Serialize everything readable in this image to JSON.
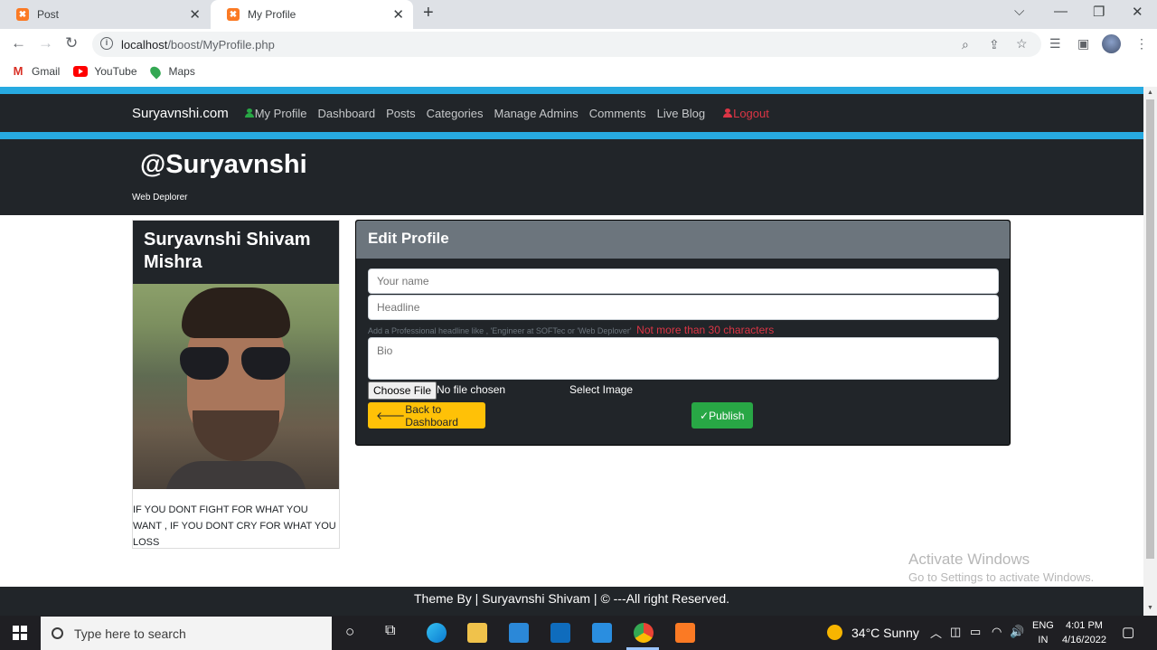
{
  "browser": {
    "tabs": [
      {
        "title": "Post",
        "active": false
      },
      {
        "title": "My Profile",
        "active": true
      }
    ],
    "url_host": "localhost",
    "url_path": "/boost/MyProfile.php",
    "bookmarks": [
      "Gmail",
      "YouTube",
      "Maps"
    ]
  },
  "site": {
    "brand": "Suryavnshi.com",
    "nav": [
      "My Profile",
      "Dashboard",
      "Posts",
      "Categories",
      "Manage Admins",
      "Comments",
      "Live Blog"
    ],
    "logout": "Logout",
    "accent_color": "#27aae1"
  },
  "header": {
    "handle": "@Suryavnshi",
    "subtitle": "Web Deplorer"
  },
  "profile_card": {
    "name": "Suryavnshi Shivam Mishra",
    "quote": "IF YOU DONT FIGHT FOR WHAT YOU WANT , IF YOU DONT CRY FOR WHAT YOU LOSS"
  },
  "edit_profile": {
    "title": "Edit Profile",
    "name_placeholder": "Your name",
    "headline_placeholder": "Headline",
    "headline_hint": "Add a Professional headline like , 'Engineer at SOFTec or 'Web Deplover'",
    "headline_warning": "Not more than 30 characters",
    "bio_placeholder": "Bio",
    "choose_file": "Choose File",
    "no_file": "No file chosen",
    "select_image": "Select Image",
    "back_button": "Back to Dashboard",
    "publish_button": "Publish"
  },
  "watermark": {
    "line1": "Activate Windows",
    "line2": "Go to Settings to activate Windows."
  },
  "footer": {
    "text": "Theme By | Suryavnshi Shivam | © ---All right Reserved."
  },
  "taskbar": {
    "search_placeholder": "Type here to search",
    "weather": "34°C  Sunny",
    "lang": "ENG",
    "region": "IN",
    "time": "4:01 PM",
    "date": "4/16/2022"
  }
}
